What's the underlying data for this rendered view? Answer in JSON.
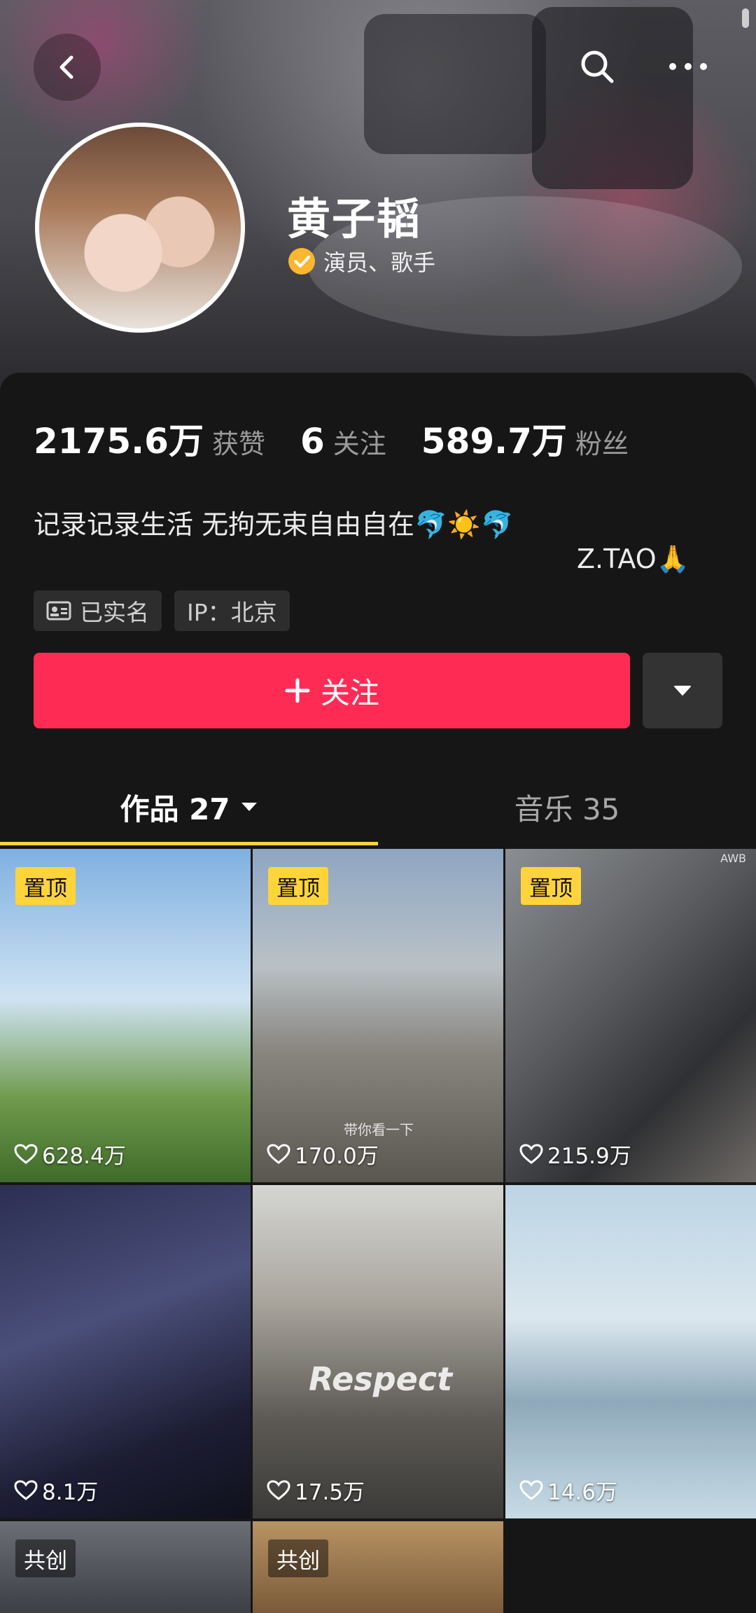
{
  "header": {
    "back_icon": "chevron-left-icon",
    "search_icon": "search-icon",
    "more_icon": "more-horizontal-icon"
  },
  "profile": {
    "name": "黄子韬",
    "verified_label": "演员、歌手",
    "verified_color": "#fcb62f"
  },
  "stats": {
    "likes_value": "2175.6万",
    "likes_label": "获赞",
    "following_value": "6",
    "following_label": "关注",
    "followers_value": "589.7万",
    "followers_label": "粉丝"
  },
  "bio": {
    "line1": "记录记录生活 无拘无束自由自在🐬☀️🐬",
    "line2": "Z.TAO🙏"
  },
  "chips": {
    "realname": "已实名",
    "ip": "IP：北京"
  },
  "actions": {
    "follow_label": "关注",
    "follow_color": "#fe2c55"
  },
  "tabs": {
    "works_label": "作品 27",
    "music_label": "音乐 35",
    "underline_color": "#fcd33c"
  },
  "grid": {
    "pin_label": "置顶",
    "cocreate_label": "共创",
    "videos": [
      {
        "likes": "628.4万",
        "pinned": true
      },
      {
        "likes": "170.0万",
        "pinned": true,
        "caption": "带你看一下"
      },
      {
        "likes": "215.9万",
        "pinned": true,
        "corner_text": "AWB"
      },
      {
        "likes": "8.1万"
      },
      {
        "likes": "17.5万",
        "overlay_text": "Respect"
      },
      {
        "likes": "14.6万"
      }
    ]
  }
}
